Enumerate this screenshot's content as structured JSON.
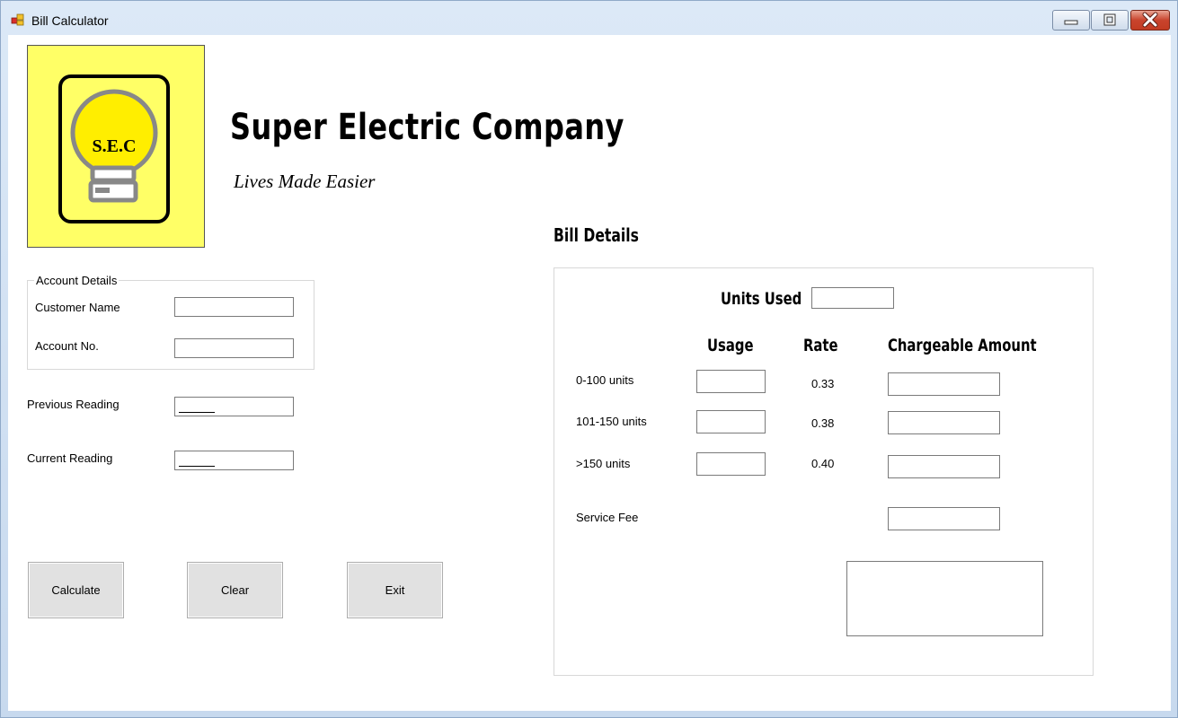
{
  "window": {
    "title": "Bill Calculator"
  },
  "header": {
    "company": "Super Electric Company",
    "slogan": "Lives Made Easier",
    "logo_text": "S.E.C"
  },
  "account": {
    "group_label": "Account Details",
    "customer_name_label": "Customer Name",
    "account_no_label": "Account No.",
    "customer_name_value": "",
    "account_no_value": ""
  },
  "readings": {
    "previous_label": "Previous Reading",
    "current_label": "Current Reading",
    "previous_value": "",
    "current_value": ""
  },
  "buttons": {
    "calculate": "Calculate",
    "clear": "Clear",
    "exit": "Exit"
  },
  "bill": {
    "title": "Bill Details",
    "units_used_label": "Units Used",
    "headers": {
      "usage": "Usage",
      "rate": "Rate",
      "amount": "Chargeable Amount"
    },
    "tiers": [
      {
        "label": "0-100 units",
        "rate": "0.33"
      },
      {
        "label": "101-150 units",
        "rate": "0.38"
      },
      {
        "label": ">150 units",
        "rate": "0.40"
      }
    ],
    "service_fee_label": "Service Fee"
  },
  "icons": {
    "app": "app-window-icon",
    "minimize": "minimize-icon",
    "maximize": "maximize-icon",
    "close": "close-icon",
    "logo": "lightbulb-logo-icon"
  },
  "colors": {
    "logo_bg": "#ffff66",
    "bulb": "#ffee00",
    "close_button": "#c9442d"
  }
}
